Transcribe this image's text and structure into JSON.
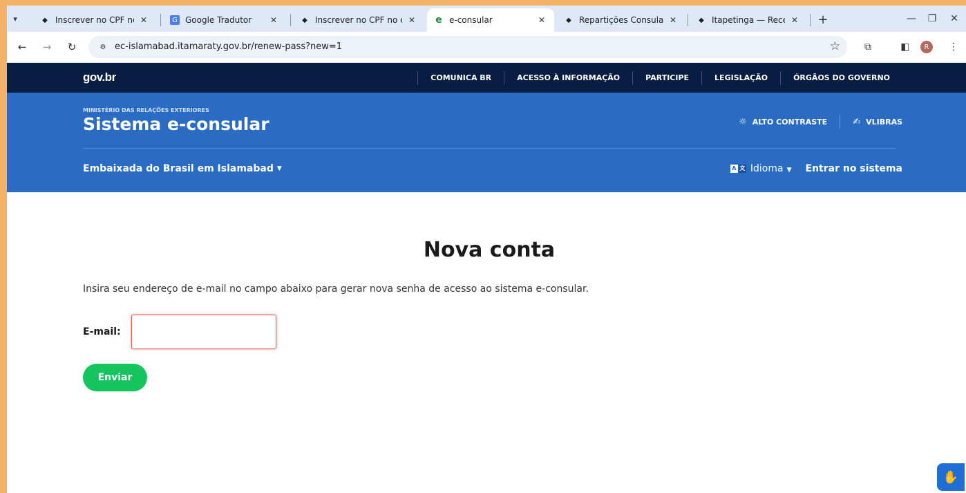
{
  "browser": {
    "tabs": [
      {
        "title": "Inscrever no CPF no e",
        "favicon": "govbr-favicon",
        "active": false
      },
      {
        "title": "Google Tradutor",
        "favicon": "google-translate-favicon",
        "active": false
      },
      {
        "title": "Inscrever no CPF no e",
        "favicon": "govbr-favicon",
        "active": false
      },
      {
        "title": "e-consular",
        "favicon": "e-consular-favicon",
        "active": true
      },
      {
        "title": "Repartições Consular",
        "favicon": "govbr-favicon",
        "active": false
      },
      {
        "title": "Itapetinga — Receita",
        "favicon": "govbr-favicon",
        "active": false
      }
    ],
    "url": "ec-islamabad.itamaraty.gov.br/renew-pass?new=1",
    "profile_initial": "R"
  },
  "gov_header": {
    "logo": "gov.br",
    "nav": [
      "COMUNICA BR",
      "ACESSO À INFORMAÇÃO",
      "PARTICIPE",
      "LEGISLAÇÃO",
      "ÓRGÃOS DO GOVERNO"
    ]
  },
  "site_header": {
    "ministry": "MINISTÉRIO DAS RELAÇÕES EXTERIORES",
    "title": "Sistema e-consular",
    "high_contrast": "ALTO CONTRASTE",
    "vlibras": "VLIBRAS",
    "embassy": "Embaixada do Brasil em Islamabad",
    "language": "Idioma",
    "login": "Entrar no sistema"
  },
  "main": {
    "title": "Nova conta",
    "instruction": "Insira seu endereço de e-mail no campo abaixo para gerar nova senha de acesso ao sistema e-consular.",
    "email_label": "E-mail:",
    "email_value": "",
    "submit_label": "Enviar"
  },
  "colors": {
    "gov_bar": "#071d41",
    "header_blue": "#2a6bc3",
    "submit_green": "#16c45e",
    "input_error": "#e05a5a"
  }
}
